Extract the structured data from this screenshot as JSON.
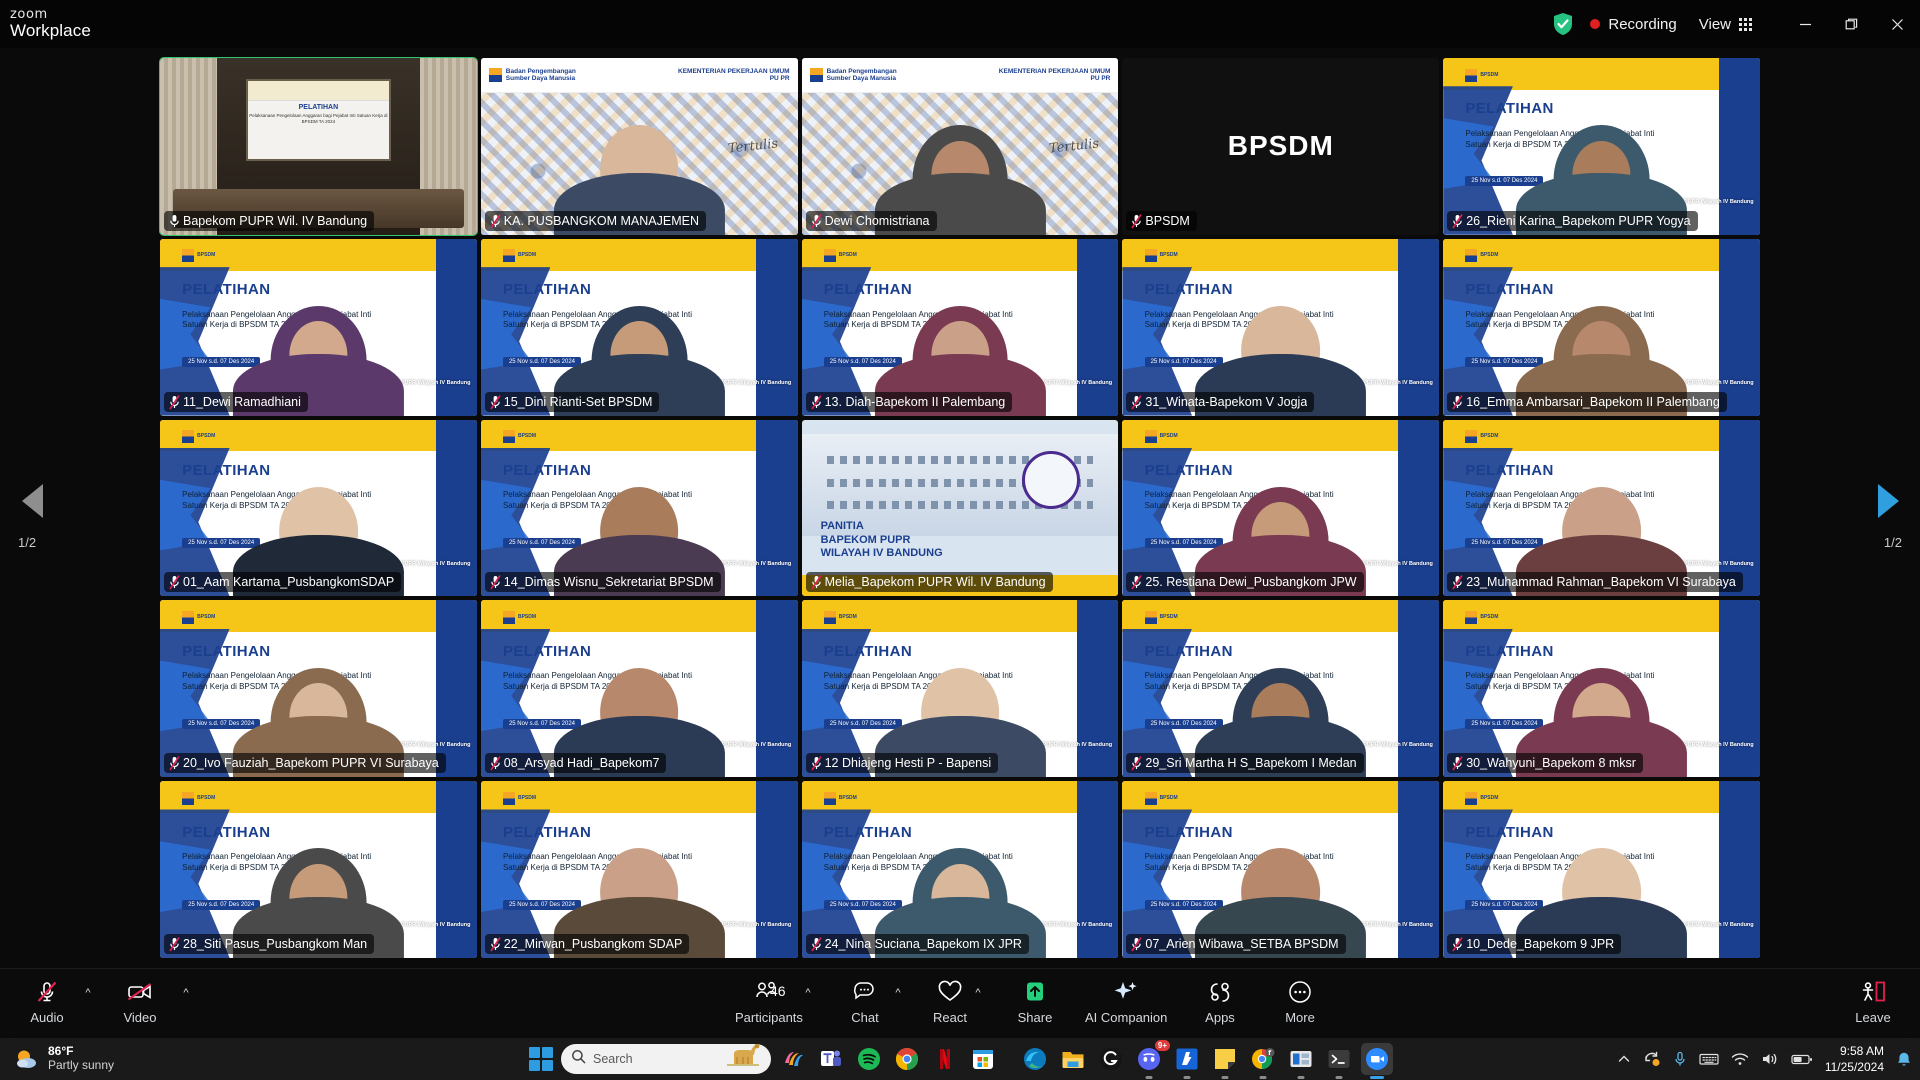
{
  "titlebar": {
    "brand_small": "zoom",
    "brand_large": "Workplace",
    "security_icon": "shield-check-icon",
    "recording_label": "Recording",
    "view_label": "View",
    "view_icon": "grid-icon",
    "minimize_icon": "minimize-icon",
    "restore_icon": "restore-icon",
    "close_icon": "close-icon"
  },
  "gallery": {
    "page_left": "1/2",
    "page_right": "1/2",
    "prev_icon": "chevron-left-icon",
    "next_icon": "chevron-right-icon",
    "slide": {
      "logo_text": "BPSDM",
      "title": "PELATIHAN",
      "subtitle": "Pelaksanaan Pengelolaan Anggaran bagi  Pejabat Inti Satuan Kerja di BPSDM TA 2024",
      "date": "25 Nov s.d. 07 Des 2024",
      "footer": "Balai Pengembangan Kompetensi PUPR Wilayah IV Bandung"
    },
    "banner": {
      "org_line1": "Badan Pengembangan",
      "org_line2": "Sumber Daya Manusia",
      "ministry": "KEMENTERIAN PEKERJAAN UMUM",
      "ministry2": "PU PR",
      "signature": "Tertulis"
    },
    "panitia": {
      "line1": "PANITIA",
      "line2": "BAPEKOM PUPR",
      "line3": "WILAYAH IV BANDUNG"
    },
    "tiles": [
      {
        "name": "Bapekom PUPR Wil. IV Bandung",
        "kind": "room",
        "active": true,
        "muted": false
      },
      {
        "name": "KA. PUSBANGKOM MANAJEMEN",
        "kind": "banner",
        "active": false,
        "muted": true
      },
      {
        "name": "Dewi Chomistriana",
        "kind": "banner",
        "active": false,
        "muted": true
      },
      {
        "name": "BPSDM",
        "kind": "plain",
        "active": false,
        "muted": true
      },
      {
        "name": "26_Rieni Karina_Bapekom PUPR Yogya",
        "kind": "slide",
        "active": false,
        "muted": true
      },
      {
        "name": "11_Dewi Ramadhiani",
        "kind": "slide",
        "active": false,
        "muted": true
      },
      {
        "name": "15_Dini Rianti-Set BPSDM",
        "kind": "slide",
        "active": false,
        "muted": true
      },
      {
        "name": "13. Diah-Bapekom II Palembang",
        "kind": "slide",
        "active": false,
        "muted": true
      },
      {
        "name": "31_Winata-Bapekom V Jogja",
        "kind": "slide",
        "active": false,
        "muted": true
      },
      {
        "name": "16_Emma Ambarsari_Bapekom II Palembang",
        "kind": "slide",
        "active": false,
        "muted": true
      },
      {
        "name": "01_Aam Kartama_PusbangkomSDAP",
        "kind": "slide",
        "active": false,
        "muted": true
      },
      {
        "name": "14_Dimas Wisnu_Sekretariat BPSDM",
        "kind": "slide",
        "active": false,
        "muted": true
      },
      {
        "name": "Melia_Bapekom PUPR Wil. IV Bandung",
        "kind": "panitia",
        "active": false,
        "muted": true
      },
      {
        "name": "25. Restiana Dewi_Pusbangkom JPW",
        "kind": "slide",
        "active": false,
        "muted": true
      },
      {
        "name": "23_Muhammad Rahman_Bapekom VI Surabaya",
        "kind": "slide",
        "active": false,
        "muted": true
      },
      {
        "name": "20_Ivo Fauziah_Bapekom PUPR VI Surabaya",
        "kind": "slide",
        "active": false,
        "muted": true
      },
      {
        "name": "08_Arsyad Hadi_Bapekom7",
        "kind": "slide",
        "active": false,
        "muted": true
      },
      {
        "name": "12 Dhiajeng Hesti P - Bapensi",
        "kind": "slide",
        "active": false,
        "muted": true
      },
      {
        "name": "29_Sri Martha H S_Bapekom I Medan",
        "kind": "slide",
        "active": false,
        "muted": true
      },
      {
        "name": "30_Wahyuni_Bapekom 8 mksr",
        "kind": "slide",
        "active": false,
        "muted": true
      },
      {
        "name": "28_Siti Pasus_Pusbangkom Man",
        "kind": "slide",
        "active": false,
        "muted": true
      },
      {
        "name": "22_Mirwan_Pusbangkom SDAP",
        "kind": "slide",
        "active": false,
        "muted": true
      },
      {
        "name": "24_Nina Suciana_Bapekom IX JPR",
        "kind": "slide",
        "active": false,
        "muted": true
      },
      {
        "name": "07_Arien Wibawa_SETBA BPSDM",
        "kind": "slide",
        "active": false,
        "muted": true
      },
      {
        "name": "10_Dede_Bapekom 9 JPR",
        "kind": "slide",
        "active": false,
        "muted": true
      }
    ]
  },
  "controlbar": {
    "audio": {
      "label": "Audio",
      "icon": "microphone-muted-icon",
      "has_caret": true
    },
    "video": {
      "label": "Video",
      "icon": "camera-off-icon",
      "has_caret": true
    },
    "participants": {
      "label": "Participants",
      "icon": "people-icon",
      "count": "46",
      "has_caret": true
    },
    "chat": {
      "label": "Chat",
      "icon": "chat-bubble-icon",
      "has_caret": true
    },
    "react": {
      "label": "React",
      "icon": "heart-icon",
      "has_caret": true
    },
    "share": {
      "label": "Share",
      "icon": "share-screen-icon",
      "has_caret": false
    },
    "ai_companion": {
      "label": "AI Companion",
      "icon": "sparkle-icon",
      "has_caret": false
    },
    "apps": {
      "label": "Apps",
      "icon": "apps-icon",
      "has_caret": false
    },
    "more": {
      "label": "More",
      "icon": "ellipsis-icon",
      "has_caret": false
    },
    "leave": {
      "label": "Leave",
      "icon": "leave-door-icon"
    }
  },
  "taskbar": {
    "weather": {
      "temp": "86°F",
      "desc": "Partly sunny",
      "icon": "partly-sunny-icon"
    },
    "start_icon": "windows-start-icon",
    "search": {
      "placeholder": "Search",
      "icon": "search-icon"
    },
    "apps": [
      {
        "name": "copilot-icon",
        "running": false
      },
      {
        "name": "microsoft-teams-icon",
        "running": false
      },
      {
        "name": "spotify-icon",
        "running": false
      },
      {
        "name": "google-chrome-icon",
        "running": false
      },
      {
        "name": "netflix-icon",
        "running": false
      },
      {
        "name": "microsoft-store-icon",
        "running": false
      },
      {
        "name": "microsoft-edge-icon",
        "running": false
      },
      {
        "name": "file-explorer-icon",
        "running": false
      },
      {
        "name": "logitech-g-hub-icon",
        "running": false
      },
      {
        "name": "discord-icon",
        "running": true,
        "badge": "9+"
      },
      {
        "name": "baidu-icon",
        "running": true
      },
      {
        "name": "sticky-notes-icon",
        "running": true
      },
      {
        "name": "chrome-profile-icon",
        "running": true
      },
      {
        "name": "media-player-icon",
        "running": true
      },
      {
        "name": "terminal-icon",
        "running": true
      },
      {
        "name": "zoom-icon",
        "running": true,
        "active": true
      }
    ],
    "system": {
      "chevron_icon": "chevron-up-icon",
      "sync_icon": "onedrive-sync-icon",
      "mic_icon": "microphone-icon",
      "keyboard_icon": "keyboard-icon",
      "wifi_icon": "wifi-icon",
      "volume_icon": "speaker-icon",
      "battery_icon": "battery-icon",
      "time": "9:58 AM",
      "date": "11/25/2024",
      "notification_icon": "bell-icon"
    }
  }
}
